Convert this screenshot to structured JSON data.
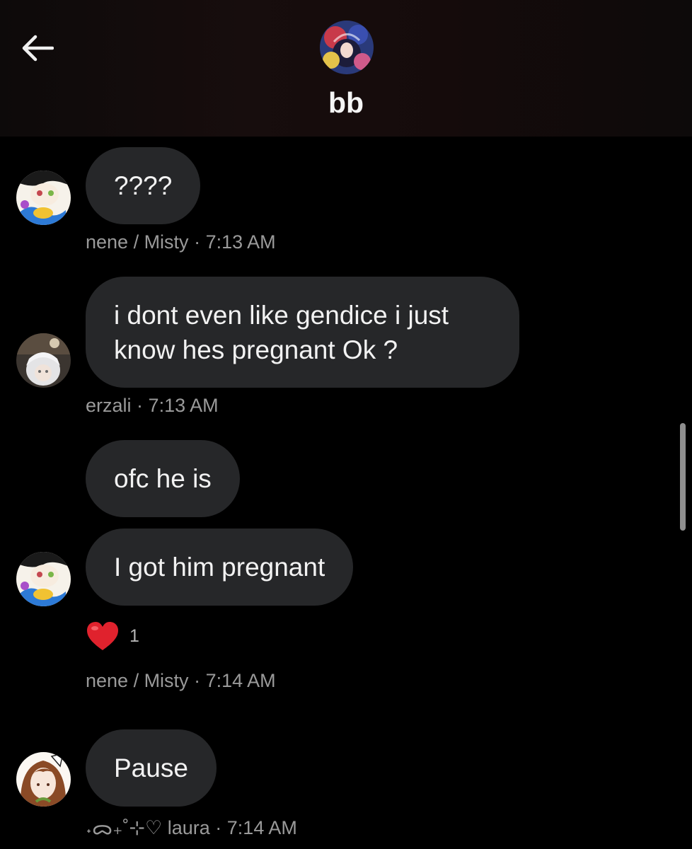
{
  "header": {
    "title": "bb",
    "back_icon": "arrow-left-icon",
    "avatar_icon": "group-avatar"
  },
  "messages": [
    {
      "sender": "nene / Misty",
      "time": "7:13 AM",
      "bubbles": [
        "????"
      ]
    },
    {
      "sender": "erzali",
      "time": "7:13 AM",
      "bubbles": [
        "i dont even like gendice i just\nknow hes pregnant Ok ?"
      ]
    },
    {
      "sender": "nene / Misty",
      "time": "7:14 AM",
      "bubbles": [
        "ofc he is",
        "I got him pregnant"
      ],
      "reaction": {
        "emoji": "❤️",
        "count": "1"
      }
    },
    {
      "sender": "˖ᯅ₊˚⊹♡ laura",
      "time": "7:14 AM",
      "bubbles": [
        "Pause"
      ]
    }
  ],
  "colors": {
    "background": "#000000",
    "bubble": "#262729",
    "meta_text": "#9a9a9a",
    "reaction_heart": "#e0222d"
  }
}
